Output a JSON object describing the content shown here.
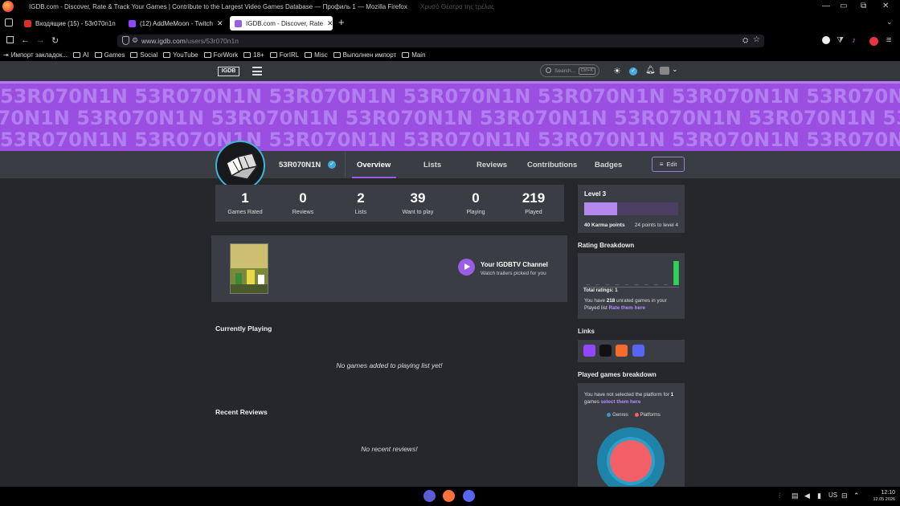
{
  "browser": {
    "window_title": "IGDB.com - Discover, Rate & Track Your Games | Contribute to the Largest Video Games Database — Профиль 1 — Mozilla Firefox",
    "window_title_ghost": "Χρυσό Θέατρο της τρέλας",
    "tabs": [
      {
        "label": "Входящие (15) - 53r070n1n",
        "color": "#d93025"
      },
      {
        "label": "(12) AddMeMoon - Twitch",
        "color": "#9146ff"
      },
      {
        "label": "IGDB.com - Discover, Rate",
        "color": "#9b5de5"
      }
    ],
    "url_host": "www.igdb.com",
    "url_path": "/users/53r070n1n",
    "bookmarks": [
      "Импорт закладок...",
      "AI",
      "Games",
      "Social",
      "YouTube",
      "ForWork",
      "18+",
      "ForIRL",
      "Misc",
      "Выполнен импорт",
      "Main"
    ]
  },
  "site": {
    "logo": "IGDB",
    "search_placeholder": "Search...",
    "search_shortcut": "Ctrl+K",
    "banner_text": "53R070N1N 53R070N1N 53R070N1N 53R070N1N 53R070N1N 53R070N1N 53R070N1N 53R070N1N 53R070N1N",
    "username": "53R070N1N",
    "tabs": [
      "Overview",
      "Lists",
      "Reviews",
      "Contributions",
      "Badges"
    ],
    "edit_label": "Edit",
    "stats": [
      {
        "value": "1",
        "label": "Games Rated"
      },
      {
        "value": "0",
        "label": "Reviews"
      },
      {
        "value": "2",
        "label": "Lists"
      },
      {
        "value": "39",
        "label": "Want to play"
      },
      {
        "value": "0",
        "label": "Playing"
      },
      {
        "value": "219",
        "label": "Played"
      }
    ],
    "igdbtv": {
      "title": "Your IGDBTV Channel",
      "subtitle": "Watch trailers picked for you"
    },
    "currently_playing": {
      "title": "Currently Playing",
      "empty": "No games added to playing list yet!"
    },
    "recent_reviews": {
      "title": "Recent Reviews",
      "empty": "No recent reviews!"
    },
    "level": {
      "title": "Level 3",
      "progress": 0.35,
      "karma": "40 Karma points",
      "to_next": "24 points to level 4"
    },
    "rating_breakdown": {
      "title": "Rating Breakdown",
      "total_label": "Total ratings: 1",
      "msg_prefix": "You have ",
      "msg_count": "218",
      "msg_suffix": " unrated games in your Played list ",
      "msg_link": "Rate them here"
    },
    "rating_chart_data": {
      "type": "bar",
      "values": [
        0,
        0,
        0,
        0,
        0,
        0,
        0,
        0,
        0,
        1
      ],
      "color": "#2fd35a"
    },
    "links": {
      "title": "Links",
      "icons": [
        {
          "name": "twitch-icon",
          "color": "#9146ff"
        },
        {
          "name": "steam-icon",
          "color": "#111111"
        },
        {
          "name": "origin-icon",
          "color": "#f56c2d"
        },
        {
          "name": "discord-icon",
          "color": "#5865f2"
        }
      ]
    },
    "played_breakdown": {
      "title": "Played games breakdown",
      "msg_prefix": "You have not selected the platform for ",
      "msg_count": "1",
      "msg_mid": " games ",
      "msg_link": "select them here",
      "legend": [
        "Genres",
        "Platforms"
      ],
      "legend_colors": [
        "#2aa0c8",
        "#f35f67"
      ]
    }
  },
  "taskbar": {
    "lang": "US",
    "time": "12:10",
    "date": "12.05.2026"
  }
}
